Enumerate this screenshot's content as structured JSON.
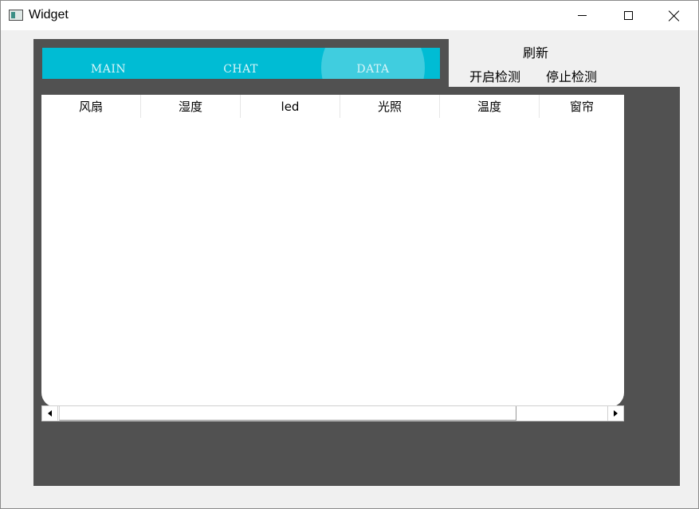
{
  "window": {
    "title": "Widget",
    "minimize_icon": "minimize-icon",
    "maximize_icon": "maximize-icon",
    "close_icon": "close-icon"
  },
  "nav": {
    "tabs": [
      {
        "label": "MAIN"
      },
      {
        "label": "CHAT"
      },
      {
        "label": "DATA"
      }
    ],
    "active_tab": "DATA",
    "accent_color": "#00bcd4"
  },
  "actions": {
    "refresh_label": "刷新",
    "start_label": "开启检测",
    "stop_label": "停止检测"
  },
  "table": {
    "columns": [
      "风扇",
      "湿度",
      "led",
      "光照",
      "温度",
      "窗帘"
    ],
    "rows": []
  },
  "colors": {
    "panel_background": "#515151",
    "window_background": "#f0f0f0"
  }
}
